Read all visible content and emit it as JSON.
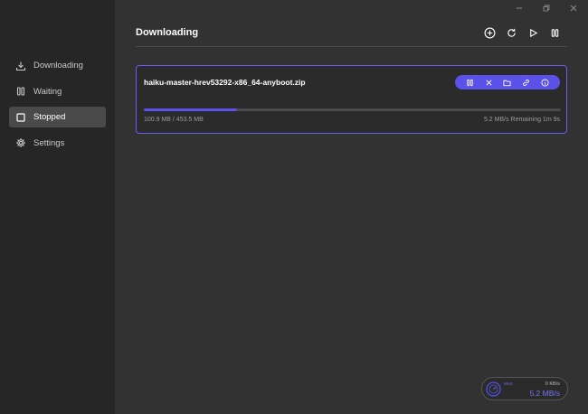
{
  "window": {
    "controls": [
      "minimize-icon",
      "restore-icon",
      "close-icon"
    ]
  },
  "sidebar": {
    "items": [
      {
        "label": "Downloading",
        "icon": "download-icon",
        "active": false
      },
      {
        "label": "Waiting",
        "icon": "pause-icon",
        "active": false
      },
      {
        "label": "Stopped",
        "icon": "stop-icon",
        "active": true
      },
      {
        "label": "Settings",
        "icon": "gear-icon",
        "active": false
      }
    ]
  },
  "header": {
    "title": "Downloading",
    "toolbar": [
      "add-task-icon",
      "refresh-icon",
      "play-icon",
      "pause-all-icon"
    ]
  },
  "task": {
    "name": "haiku-master-hrev53292-x86_64-anyboot.zip",
    "size": "100.9 MB / 453.5 MB",
    "speed": "5.2 MB/s Remaining 1m 9s",
    "progress": 0.2225,
    "actions": [
      "pause-icon",
      "delete-icon",
      "folder-icon",
      "link-icon",
      "info-icon"
    ]
  },
  "speedometer": {
    "label": "MAX",
    "upload": "0 KB/s",
    "download": "5.2 MB/s"
  },
  "colors": {
    "accent": "#5b50e8",
    "sidebar_bg": "#262626",
    "main_bg": "#323232",
    "active_nav": "#4a4a4a"
  }
}
